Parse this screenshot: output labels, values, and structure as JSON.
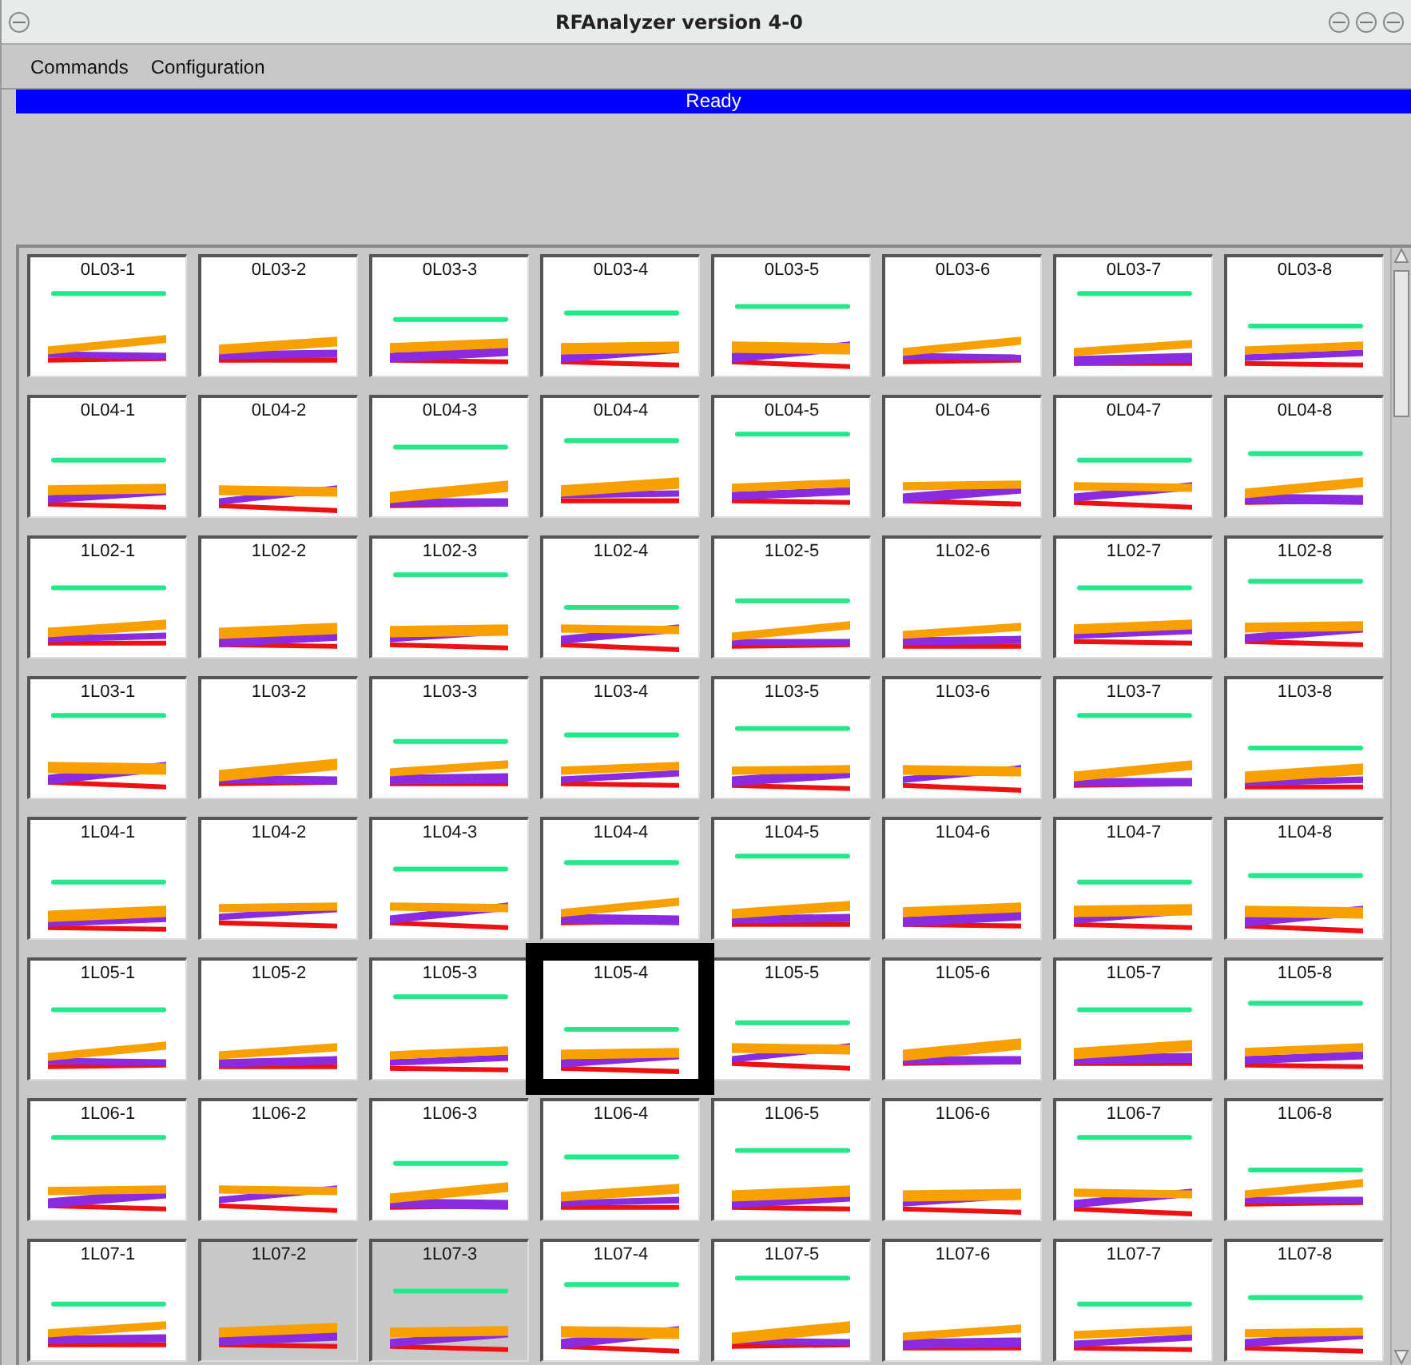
{
  "window": {
    "title": "RFAnalyzer version 4-0"
  },
  "menu": [
    "Commands",
    "Configuration"
  ],
  "status": "Ready",
  "rows": [
    {
      "tiles": [
        {
          "label": "0L03-1",
          "selected": false,
          "disabled": false
        },
        {
          "label": "0L03-2",
          "selected": false,
          "disabled": false
        },
        {
          "label": "0L03-3",
          "selected": false,
          "disabled": false
        },
        {
          "label": "0L03-4",
          "selected": false,
          "disabled": false
        },
        {
          "label": "0L03-5",
          "selected": false,
          "disabled": false
        },
        {
          "label": "0L03-6",
          "selected": false,
          "disabled": false
        },
        {
          "label": "0L03-7",
          "selected": false,
          "disabled": false
        },
        {
          "label": "0L03-8",
          "selected": false,
          "disabled": false
        }
      ]
    },
    {
      "tiles": [
        {
          "label": "0L04-1",
          "selected": false,
          "disabled": false
        },
        {
          "label": "0L04-2",
          "selected": false,
          "disabled": false
        },
        {
          "label": "0L04-3",
          "selected": false,
          "disabled": false
        },
        {
          "label": "0L04-4",
          "selected": false,
          "disabled": false
        },
        {
          "label": "0L04-5",
          "selected": false,
          "disabled": false
        },
        {
          "label": "0L04-6",
          "selected": false,
          "disabled": false
        },
        {
          "label": "0L04-7",
          "selected": false,
          "disabled": false
        },
        {
          "label": "0L04-8",
          "selected": false,
          "disabled": false
        }
      ]
    },
    {
      "tiles": [
        {
          "label": "1L02-1",
          "selected": false,
          "disabled": false
        },
        {
          "label": "1L02-2",
          "selected": false,
          "disabled": false
        },
        {
          "label": "1L02-3",
          "selected": false,
          "disabled": false
        },
        {
          "label": "1L02-4",
          "selected": false,
          "disabled": false
        },
        {
          "label": "1L02-5",
          "selected": false,
          "disabled": false
        },
        {
          "label": "1L02-6",
          "selected": false,
          "disabled": false
        },
        {
          "label": "1L02-7",
          "selected": false,
          "disabled": false
        },
        {
          "label": "1L02-8",
          "selected": false,
          "disabled": false
        }
      ]
    },
    {
      "tiles": [
        {
          "label": "1L03-1",
          "selected": false,
          "disabled": false
        },
        {
          "label": "1L03-2",
          "selected": false,
          "disabled": false
        },
        {
          "label": "1L03-3",
          "selected": false,
          "disabled": false
        },
        {
          "label": "1L03-4",
          "selected": false,
          "disabled": false
        },
        {
          "label": "1L03-5",
          "selected": false,
          "disabled": false
        },
        {
          "label": "1L03-6",
          "selected": false,
          "disabled": false
        },
        {
          "label": "1L03-7",
          "selected": false,
          "disabled": false
        },
        {
          "label": "1L03-8",
          "selected": false,
          "disabled": false
        }
      ]
    },
    {
      "tiles": [
        {
          "label": "1L04-1",
          "selected": false,
          "disabled": false
        },
        {
          "label": "1L04-2",
          "selected": false,
          "disabled": false
        },
        {
          "label": "1L04-3",
          "selected": false,
          "disabled": false
        },
        {
          "label": "1L04-4",
          "selected": false,
          "disabled": false
        },
        {
          "label": "1L04-5",
          "selected": false,
          "disabled": false
        },
        {
          "label": "1L04-6",
          "selected": false,
          "disabled": false
        },
        {
          "label": "1L04-7",
          "selected": false,
          "disabled": false
        },
        {
          "label": "1L04-8",
          "selected": false,
          "disabled": false
        }
      ]
    },
    {
      "tiles": [
        {
          "label": "1L05-1",
          "selected": false,
          "disabled": false
        },
        {
          "label": "1L05-2",
          "selected": false,
          "disabled": false
        },
        {
          "label": "1L05-3",
          "selected": false,
          "disabled": false
        },
        {
          "label": "1L05-4",
          "selected": true,
          "disabled": false
        },
        {
          "label": "1L05-5",
          "selected": false,
          "disabled": false
        },
        {
          "label": "1L05-6",
          "selected": false,
          "disabled": false
        },
        {
          "label": "1L05-7",
          "selected": false,
          "disabled": false
        },
        {
          "label": "1L05-8",
          "selected": false,
          "disabled": false
        }
      ]
    },
    {
      "tiles": [
        {
          "label": "1L06-1",
          "selected": false,
          "disabled": false
        },
        {
          "label": "1L06-2",
          "selected": false,
          "disabled": false
        },
        {
          "label": "1L06-3",
          "selected": false,
          "disabled": false
        },
        {
          "label": "1L06-4",
          "selected": false,
          "disabled": false
        },
        {
          "label": "1L06-5",
          "selected": false,
          "disabled": false
        },
        {
          "label": "1L06-6",
          "selected": false,
          "disabled": false
        },
        {
          "label": "1L06-7",
          "selected": false,
          "disabled": false
        },
        {
          "label": "1L06-8",
          "selected": false,
          "disabled": false
        }
      ]
    },
    {
      "tiles": [
        {
          "label": "1L07-1",
          "selected": false,
          "disabled": false
        },
        {
          "label": "1L07-2",
          "selected": false,
          "disabled": true
        },
        {
          "label": "1L07-3",
          "selected": false,
          "disabled": true
        },
        {
          "label": "1L07-4",
          "selected": false,
          "disabled": false
        },
        {
          "label": "1L07-5",
          "selected": false,
          "disabled": false
        },
        {
          "label": "1L07-6",
          "selected": false,
          "disabled": false
        },
        {
          "label": "1L07-7",
          "selected": false,
          "disabled": false
        },
        {
          "label": "1L07-8",
          "selected": false,
          "disabled": false
        }
      ]
    }
  ]
}
